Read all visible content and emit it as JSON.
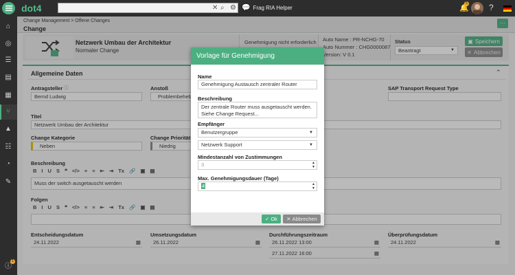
{
  "app": {
    "brand": "dot4",
    "ria_label": "Frag RIA Helper",
    "notification_count": "5",
    "info_count": "1"
  },
  "header": {
    "breadcrumb": "Change Management > Offene Changes",
    "title": "Change"
  },
  "info": {
    "title": "Netzwerk Umbau der Architektur",
    "type": "Normaler Change",
    "approval_state": "Genehmigung nicht erforderlich",
    "auto_name": "Auto Name : PR-NCHG-70",
    "auto_number": "Auto Nummer : CHG0000087",
    "version": "Version: V 0.1",
    "status_label": "Status",
    "status_value": "Beantragt"
  },
  "actions": {
    "save": "Speichern",
    "cancel": "Abbrechen"
  },
  "panel": {
    "title": "Allgemeine Daten",
    "requester_label": "Antragsteller",
    "requester_value": "Bernd Ludwig",
    "trigger_label": "Anstoß",
    "trigger_value": "Problembehebung",
    "sap_label": "SAP Transport Request Type",
    "title_label": "Titel",
    "title_value": "Netzwerk Umbau der Architektur",
    "category_label": "Change Kategorie",
    "category_value": "Neben",
    "priority_label": "Change Priorität",
    "priority_value": "Niedrig",
    "description_label": "Beschreibung",
    "description_value": "Muss der switch ausgetauscht werden",
    "consequences_label": "Folgen",
    "decision_date_label": "Entscheidungsdatum",
    "decision_date_value": "24.11.2022",
    "implementation_date_label": "Umsetzungsdatum",
    "implementation_date_value": "26.11.2022",
    "execution_period_label": "Durchführungszeitraum",
    "execution_start": "26.11.2022 13:00",
    "execution_end": "27.11.2022 16:00",
    "review_date_label": "Überprüfungsdatum",
    "review_date_value": "24.11.2022"
  },
  "editor_toolbar": [
    "B",
    "I",
    "U",
    "S",
    "❝",
    "</>",
    "≡",
    "≡",
    "⇤",
    "⇥",
    "Tx",
    "🔗",
    "▣",
    "▤"
  ],
  "modal": {
    "title": "Vorlage für Genehmigung",
    "name_label": "Name",
    "name_value": "Genehmigung Austausch zentraler Router",
    "description_label": "Beschreibung",
    "description_line1": "Der zentrale Router muss ausgetauscht werden.",
    "description_line2": "Siehe Change Request...",
    "recipient_label": "Empfänger",
    "recipient_type": "Benutzergruppe",
    "recipient_value": "Netzwerk Support",
    "min_approvals_label": "Mindestanzahl von Zustimmungen",
    "min_approvals_value": "3",
    "max_duration_label": "Max. Genehmigungsdauer (Tage)",
    "max_duration_value": "4",
    "ok": "Ok",
    "cancel": "Abbrechen"
  },
  "colors": {
    "accent": "#4caf82",
    "topbar": "#2d2d2d",
    "badge": "#f0a830"
  }
}
